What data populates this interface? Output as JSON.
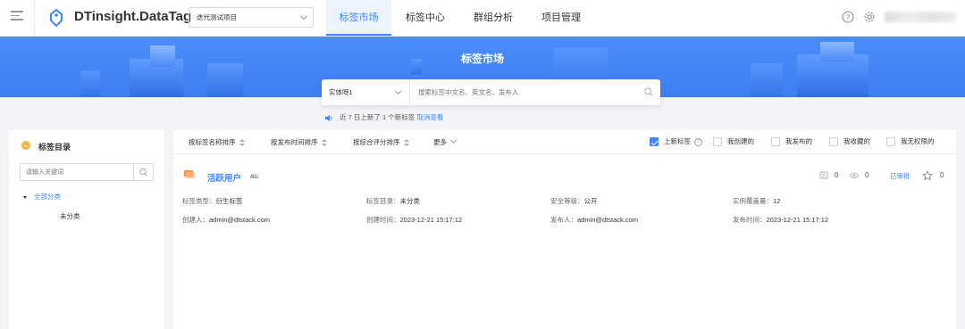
{
  "app": {
    "title": "DTinsight.DataTag"
  },
  "project_select": {
    "value": "迭代测试项目"
  },
  "nav": {
    "tabs": [
      "标签市场",
      "标签中心",
      "群组分析",
      "项目管理"
    ],
    "active": 0
  },
  "banner": {
    "title": "标签市场"
  },
  "search": {
    "entity": "实体呀1",
    "placeholder": "搜索标签中文名、英文名、发布人"
  },
  "notice": {
    "prefix": "近 7 日上新了 1 个新标签",
    "link": "取消查看"
  },
  "sidebar": {
    "title": "标签目录",
    "search_placeholder": "请输入关键词",
    "tree_root": "全部分类",
    "tree_child": "未分类"
  },
  "sort": {
    "by_name": "按标签名称排序",
    "by_time": "按发布时间排序",
    "by_score": "按综合评分排序",
    "more": "更多"
  },
  "filters": [
    {
      "label": "上新标签",
      "checked": true
    },
    {
      "label": "我创建的",
      "checked": false
    },
    {
      "label": "我发布的",
      "checked": false
    },
    {
      "label": "我收藏的",
      "checked": false
    },
    {
      "label": "我无权限的",
      "checked": false
    }
  ],
  "tag": {
    "name": "活跃用户",
    "code": "au",
    "comments": "0",
    "views": "0",
    "status": "已审批",
    "favorites": "0",
    "type_label": "标签类型：",
    "type_value": "衍生标签",
    "catalog_label": "标签目录：",
    "catalog_value": "未分类",
    "security_label": "安全等级：",
    "security_value": "公开",
    "coverage_label": "实例覆盖量：",
    "coverage_value": "12",
    "creator_label": "创建人：",
    "creator_value": "admin@dtstack.com",
    "created_label": "创建时间：",
    "created_value": "2023-12-21 15:17:12",
    "publisher_label": "发布人：",
    "publisher_value": "admin@dtstack.com",
    "published_label": "发布时间：",
    "published_value": "2023-12-21 15:17:12"
  },
  "colors": {
    "accent": "#3f87ff",
    "banner": "#4a8df9",
    "folder": "#f5b73b",
    "tag_icon": "#ff8c3a"
  }
}
